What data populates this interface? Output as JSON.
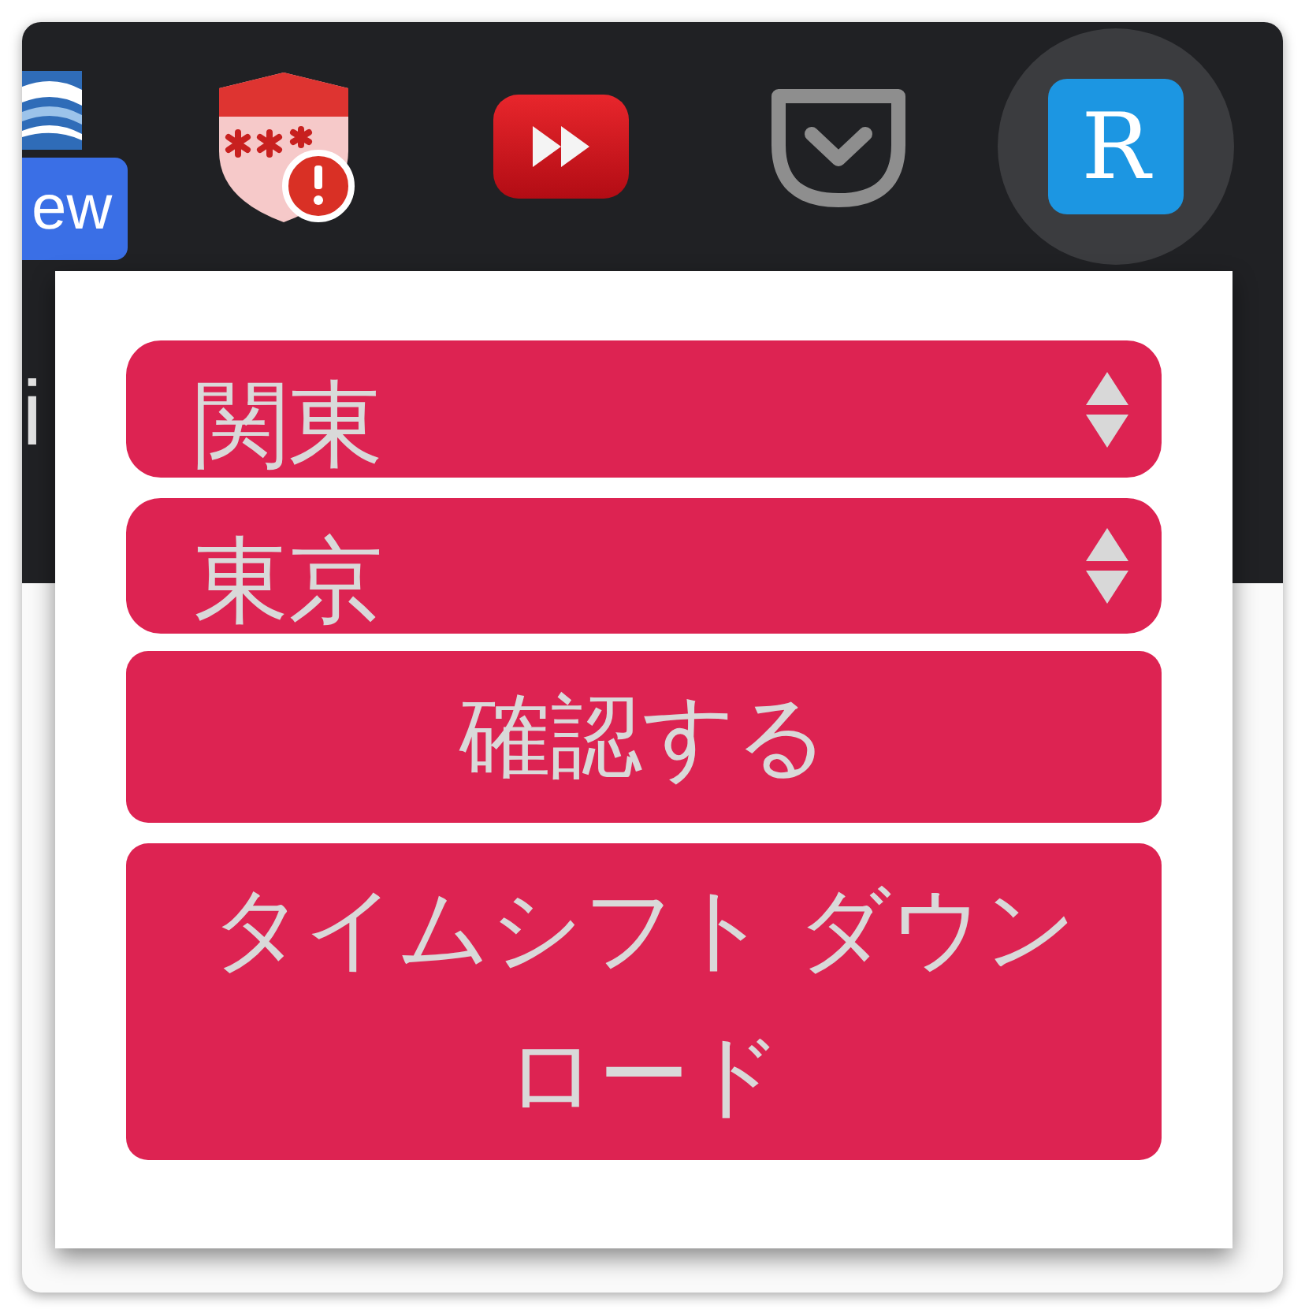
{
  "toolbar": {
    "extensions": [
      {
        "kind": "stripes",
        "badge": "ew",
        "selected": false
      },
      {
        "kind": "shield-alert",
        "selected": false
      },
      {
        "kind": "fast-forward",
        "selected": false
      },
      {
        "kind": "pocket",
        "selected": false
      },
      {
        "kind": "letter-tile",
        "letter": "R",
        "selected": true
      }
    ]
  },
  "page_behind": {
    "text": "i"
  },
  "popup": {
    "selects": [
      {
        "value": "関東"
      },
      {
        "value": "東京"
      }
    ],
    "buttons": [
      {
        "label": "確認する"
      },
      {
        "label": "タイムシフト ダウンロード"
      }
    ]
  }
}
